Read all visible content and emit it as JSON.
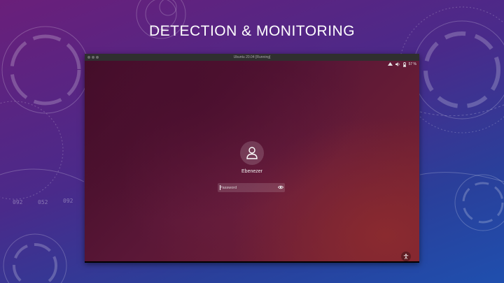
{
  "slide": {
    "title": "DETECTION & MONITORING",
    "decor_ticks": [
      "092",
      "052",
      "092"
    ]
  },
  "vm_window": {
    "title": "Ubuntu 20.04 [Running]"
  },
  "status_bar": {
    "icons": [
      "network-icon",
      "volume-icon",
      "battery-icon"
    ],
    "battery_text": "57 %"
  },
  "login": {
    "avatar_icon": "user-icon",
    "username": "Ebenezer",
    "password_placeholder": "Password",
    "reveal_icon": "eye-icon",
    "accessibility_icon": "accessibility-icon"
  },
  "colors": {
    "slide_bg_top": "#6a1f7a",
    "slide_bg_bottom": "#1f4fae",
    "screen_bg": "#5a1737",
    "text": "#ffffff"
  }
}
